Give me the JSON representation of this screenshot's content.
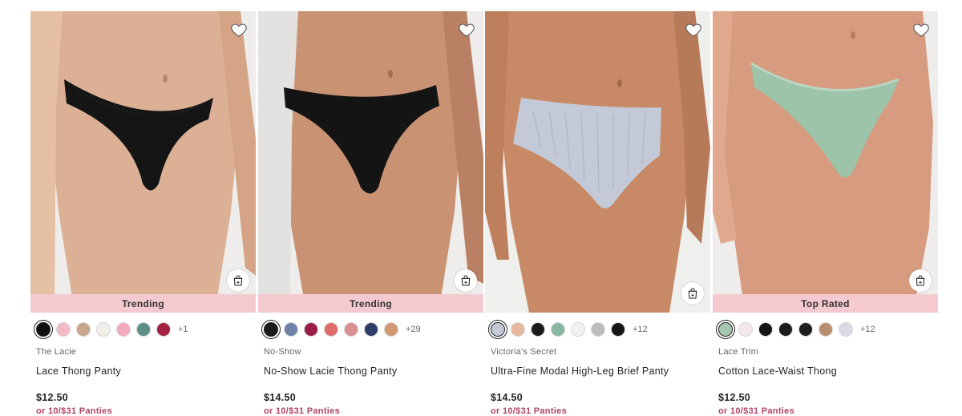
{
  "products": [
    {
      "badge": "Trending",
      "swatches": [
        "#111111",
        "#f3b9c6",
        "#c9a58e",
        "#f2eee8",
        "#f5a9bd",
        "#5b8f88",
        "#a3213f"
      ],
      "more_colors": "+1",
      "brand": "The Lacie",
      "name": "Lace Thong Panty",
      "price": "$12.50",
      "promo": "or 10/$31 Panties"
    },
    {
      "badge": "Trending",
      "swatches": [
        "#1a1a1a",
        "#6e83a8",
        "#9c1c4a",
        "#e06b6b",
        "#d99091",
        "#2e3e66",
        "#d29a72"
      ],
      "more_colors": "+29",
      "brand": "No-Show",
      "name": "No-Show Lacie Thong Panty",
      "price": "$14.50",
      "promo": "or 10/$31 Panties"
    },
    {
      "badge": "",
      "swatches": [
        "#c3c9d6",
        "#e7b9a1",
        "#1b1b1b",
        "#86b8a2",
        "#f2f2f2",
        "#bcbcbc",
        "#141414"
      ],
      "more_colors": "+12",
      "brand": "Victoria's Secret",
      "name": "Ultra-Fine Modal High-Leg Brief Panty",
      "price": "$14.50",
      "promo": "or 10/$31 Panties"
    },
    {
      "badge": "Top Rated",
      "swatches": [
        "#a6c8b2",
        "#f4e6ea",
        "#151515",
        "#1c1c1c",
        "#1f1f1f",
        "#b98e6e",
        "#dcd9e4"
      ],
      "more_colors": "+12",
      "brand": "Lace Trim",
      "name": "Cotton Lace-Waist Thong",
      "price": "$12.50",
      "promo": "or 10/$31 Panties"
    }
  ],
  "icons": {
    "wishlist": "heart-icon",
    "quick_add": "shopping-bag-icon"
  },
  "colors": {
    "badge_bg": "#f4c9d0",
    "promo": "#b0456a"
  }
}
